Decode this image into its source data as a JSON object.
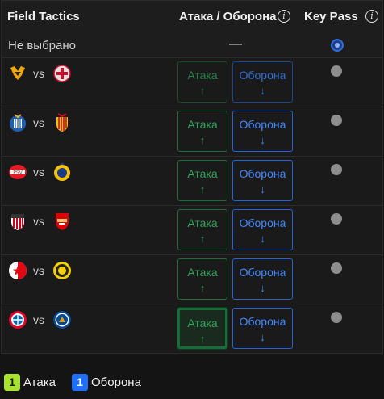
{
  "header": {
    "title": "Field Tactics",
    "attack_defense": "Атака / Оборона",
    "key_pass": "Key Pass",
    "info_glyph": "i"
  },
  "none_row": {
    "label": "Не выбрано",
    "dash": "—",
    "key_pass_selected": true
  },
  "matches": [
    {
      "home_logo": "wolves-logo",
      "vs": "vs",
      "away_logo": "cremonese-logo",
      "attack": "Атака",
      "attack_arrow": "↑",
      "defense": "Оборона",
      "defense_arrow": "↓",
      "key_pass_selected": false
    },
    {
      "home_logo": "espanyol-logo",
      "vs": "vs",
      "away_logo": "mallorca-logo",
      "attack": "Атака",
      "attack_arrow": "↑",
      "defense": "Оборона",
      "defense_arrow": "↓",
      "key_pass_selected": false
    },
    {
      "home_logo": "psv-logo",
      "vs": "vs",
      "away_logo": "union-sg-logo",
      "attack": "Атака",
      "attack_arrow": "↑",
      "defense": "Оборона",
      "defense_arrow": "↓",
      "key_pass_selected": false
    },
    {
      "home_logo": "athletic-bilbao-logo",
      "vs": "vs",
      "away_logo": "arsenal-logo",
      "attack": "Атака",
      "attack_arrow": "↑",
      "defense": "Оборона",
      "defense_arrow": "↓",
      "key_pass_selected": false
    },
    {
      "home_logo": "slavia-praha-logo",
      "vs": "vs",
      "away_logo": "bodo-glimt-logo",
      "attack": "Атака",
      "attack_arrow": "↑",
      "defense": "Оборона",
      "defense_arrow": "↓",
      "key_pass_selected": false
    },
    {
      "home_logo": "bayern-munich-logo",
      "vs": "vs",
      "away_logo": "chelsea-logo",
      "attack": "Атака",
      "attack_arrow": "↑",
      "defense": "Оборона",
      "defense_arrow": "↓",
      "key_pass_selected": false
    }
  ],
  "legend": {
    "attack_count": "1",
    "attack_label": "Атака",
    "defense_count": "1",
    "defense_label": "Оборона"
  },
  "colors": {
    "attack": "#2fa35a",
    "defense": "#3f86ff",
    "attack_badge": "#a6e22e",
    "defense_badge": "#1f6fff"
  }
}
